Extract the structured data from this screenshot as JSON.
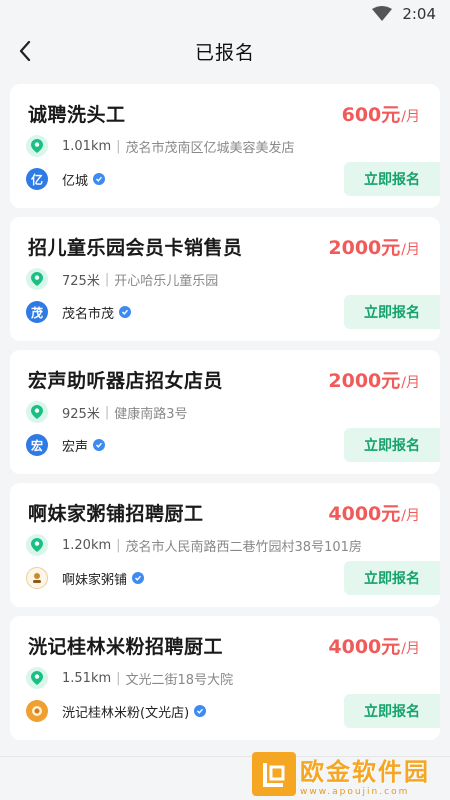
{
  "status_bar": {
    "time": "2:04"
  },
  "header": {
    "title": "已报名"
  },
  "jobs": [
    {
      "title": "诚聘洗头工",
      "salary": "600元",
      "salary_unit": "/月",
      "distance": "1.01km",
      "address": "茂名市茂南区亿城美容美发店",
      "company": "亿城",
      "company_avatar": "亿",
      "apply_label": "立即报名"
    },
    {
      "title": "招儿童乐园会员卡销售员",
      "salary": "2000元",
      "salary_unit": "/月",
      "distance": "725米",
      "address": "开心哈乐儿童乐园",
      "company": "茂名市茂",
      "company_avatar": "茂",
      "apply_label": "立即报名"
    },
    {
      "title": "宏声助听器店招女店员",
      "salary": "2000元",
      "salary_unit": "/月",
      "distance": "925米",
      "address": "健康南路3号",
      "company": "宏声",
      "company_avatar": "宏",
      "apply_label": "立即报名"
    },
    {
      "title": "啊妹家粥铺招聘厨工",
      "salary": "4000元",
      "salary_unit": "/月",
      "distance": "1.20km",
      "address": "茂名市人民南路西二巷竹园村38号101房",
      "company": "啊妹家粥铺",
      "company_avatar": "",
      "apply_label": "立即报名"
    },
    {
      "title": "洸记桂林米粉招聘厨工",
      "salary": "4000元",
      "salary_unit": "/月",
      "distance": "1.51km",
      "address": "文光二街18号大院",
      "company": "洸记桂林米粉(文光店)",
      "company_avatar": "",
      "apply_label": "立即报名"
    }
  ],
  "watermark": {
    "name": "欧金软件园",
    "url": "www.apoujin.com"
  },
  "colors": {
    "salary": "#f25a5a",
    "apply_bg": "#e3f7ef",
    "apply_text": "#15a36b",
    "pin_bg": "#d9f6ec"
  },
  "icons": {
    "back": "chevron-left-icon",
    "location": "location-pin-icon",
    "verified": "verified-check-icon",
    "wifi": "wifi-icon"
  }
}
